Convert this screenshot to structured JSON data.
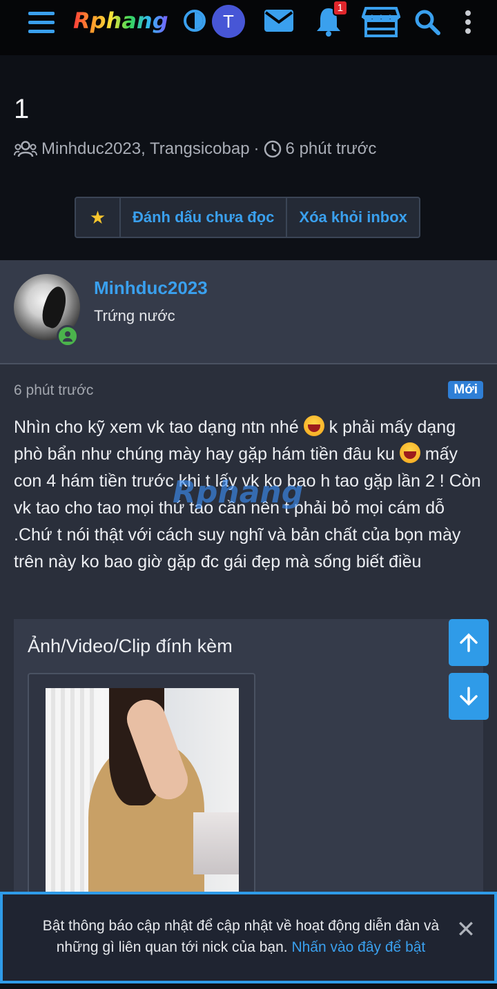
{
  "topbar": {
    "logo": "Rphang",
    "avatar_letter": "T",
    "notifications_count": "1",
    "icons": [
      "menu-icon",
      "contrast-icon",
      "mail-icon",
      "bell-icon",
      "store-icon",
      "search-icon",
      "more-vertical-icon"
    ],
    "accent_color": "#3aa0ee"
  },
  "thread": {
    "title": "1",
    "participants": "Minhduc2023, Trangsicobap",
    "separator": "·",
    "time": "6 phút trước"
  },
  "actions": {
    "star": "★",
    "mark_unread": "Đánh dấu chưa đọc",
    "remove_inbox": "Xóa khỏi inbox"
  },
  "author": {
    "name": "Minhduc2023",
    "rank": "Trứng nước",
    "online": true
  },
  "message": {
    "time": "6 phút trước",
    "badge": "Mới",
    "text_1": "Nhìn cho kỹ xem vk tao dạng ntn nhé ",
    "text_2": " k phải mấy dạng phò bẩn như chúng mày hay gặp hám tiền đâu ku ",
    "text_3": " mấy con 4 hám tiền trước khi t lấy vk ko bao h tao gặp lần 2 ! Còn vk tao cho tao mọi thứ tao cần nên t phải bỏ mọi cám dỗ .Chứ t nói thật với cách suy nghĩ và bản chất của bọn mày trên này ko bao giờ gặp đc gái đẹp mà sống biết điều",
    "watermark": "Rphang"
  },
  "attachments": {
    "title": "Ảnh/Video/Clip đính kèm"
  },
  "notice": {
    "text": "Bật thông báo cập nhật để cập nhật về hoạt động diễn đàn và những gì liên quan tới nick của bạn. ",
    "link": "Nhấn vào đây để bật",
    "close": "✕"
  }
}
